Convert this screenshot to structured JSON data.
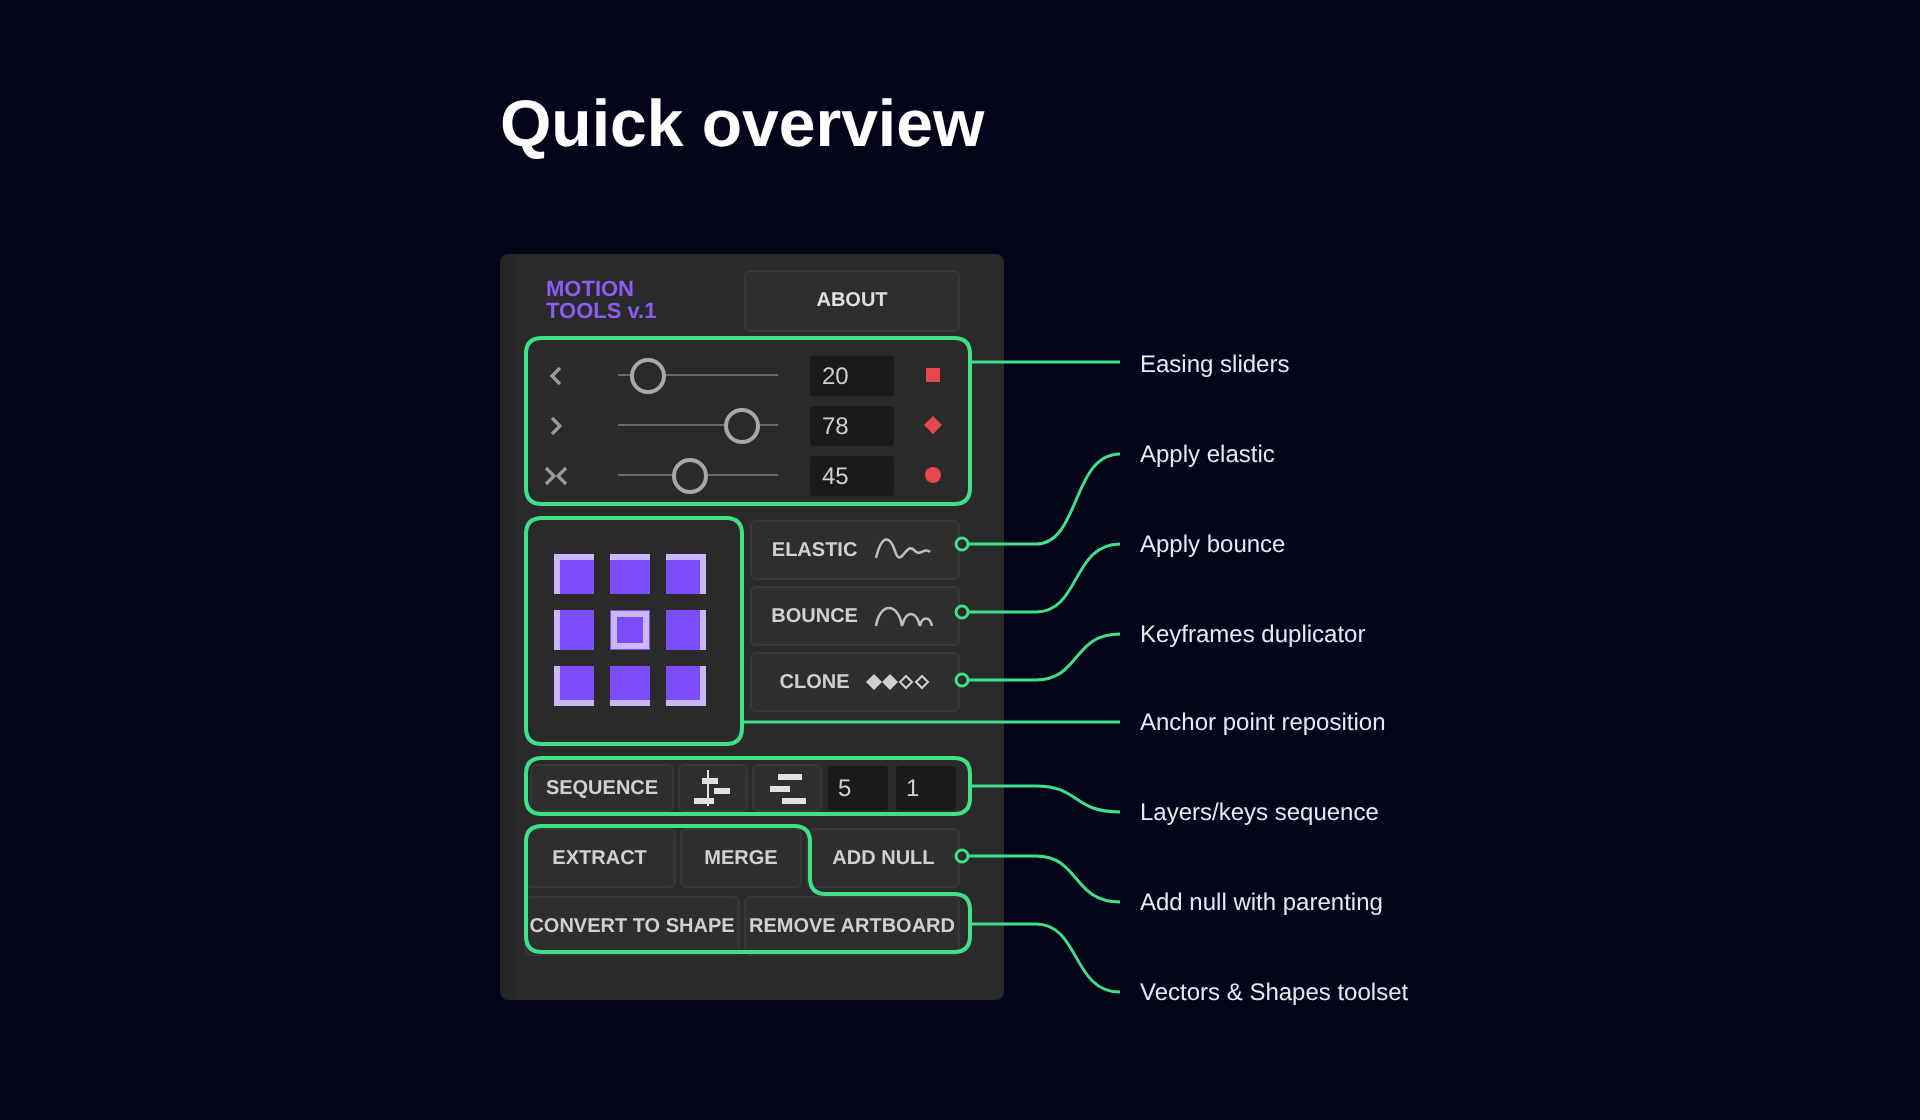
{
  "heading": "Quick overview",
  "panel": {
    "title_lines": [
      "MOTION",
      "TOOLS v.1"
    ],
    "about_button": "ABOUT",
    "sliders": [
      {
        "kind": "in",
        "level": 0.19,
        "value": "20",
        "color": "#e5484d"
      },
      {
        "kind": "out",
        "level": 0.78,
        "value": "78",
        "color": "#e5484d"
      },
      {
        "kind": "both",
        "level": 0.45,
        "value": "45",
        "color": "#e5484d"
      }
    ],
    "effect_buttons": [
      {
        "label": "ELASTIC",
        "kind": "elastic"
      },
      {
        "label": "BOUNCE",
        "kind": "bounce"
      },
      {
        "label": "CLONE",
        "kind": "clone"
      }
    ],
    "sequence": {
      "label": "SEQUENCE",
      "fields": [
        "5",
        "1"
      ]
    },
    "tool_rows": [
      [
        "EXTRACT",
        "MERGE",
        "ADD NULL"
      ],
      [
        "CONVERT TO SHAPE",
        "REMOVE ARTBOARD"
      ]
    ]
  },
  "annotations": [
    {
      "label": "Easing sliders"
    },
    {
      "label": "Apply elastic"
    },
    {
      "label": "Apply bounce"
    },
    {
      "label": "Keyframes duplicator"
    },
    {
      "label": "Anchor point reposition"
    },
    {
      "label": "Layers/keys sequence"
    },
    {
      "label": "Add null with parenting"
    },
    {
      "label": "Vectors & Shapes toolset"
    }
  ]
}
